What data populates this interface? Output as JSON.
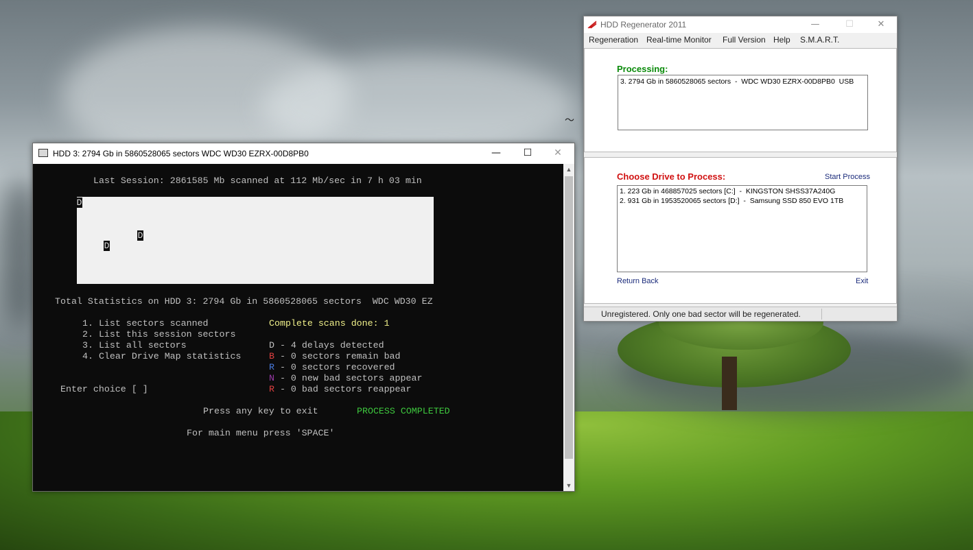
{
  "console": {
    "title": "HDD 3: 2794 Gb in 5860528065 sectors  WDC WD30 EZRX-00D8PB0",
    "minimize": "—",
    "maximize": "☐",
    "close": "✕",
    "last_session": "Last Session: 2861585 Mb scanned at 112 Mb/sec in 7 h 03 min",
    "map_markers": [
      "D",
      "D",
      "D"
    ],
    "total_stats": "Total Statistics on HDD 3: 2794 Gb in 5860528065 sectors  WDC WD30 EZ",
    "menu": [
      "1. List sectors scanned",
      "2. List this session sectors",
      "3. List all sectors",
      "4. Clear Drive Map statistics"
    ],
    "complete_scans": "Complete scans done: 1",
    "legend": [
      {
        "letter": "D",
        "text": " - 4 delays detected",
        "color": "#c0c0c0"
      },
      {
        "letter": "B",
        "text": " - 0 sectors remain bad",
        "color": "#e04040"
      },
      {
        "letter": "R",
        "text": " - 0 sectors recovered",
        "color": "#4a7ce0"
      },
      {
        "letter": "N",
        "text": " - 0 new bad sectors appear",
        "color": "#9a3aa8"
      },
      {
        "letter": "R",
        "text": " - 0 bad sectors reappear",
        "color": "#e04040"
      }
    ],
    "enter_choice": "Enter choice [ ]",
    "press_any_key": "Press any key to exit",
    "process_completed": "PROCESS COMPLETED",
    "main_menu": "For main menu press 'SPACE'"
  },
  "regen": {
    "title": "HDD Regenerator 2011",
    "menu": [
      "Regeneration",
      "Real-time Monitor",
      "Full Version",
      "Help",
      "S.M.A.R.T."
    ],
    "processing_label": "Processing:",
    "processing_item": "3. 2794 Gb in 5860528065 sectors  -  WDC WD30 EZRX-00D8PB0  USB",
    "choose_label": "Choose Drive to Process:",
    "start_process": "Start Process",
    "drives": [
      "1. 223 Gb in 468857025 sectors [C:]  -  KINGSTON SHSS37A240G",
      "2. 931 Gb in 1953520065 sectors [D:]  -  Samsung SSD 850 EVO 1TB"
    ],
    "return_back": "Return Back",
    "exit": "Exit",
    "status": "Unregistered. Only one bad sector will be regenerated."
  },
  "colors": {
    "console_bg": "#0c0c0c",
    "console_text": "#c0c0c0",
    "yellow": "#f0f08a",
    "green": "#3ec83e",
    "regen_green": "#0a8a0a",
    "regen_red": "#d01010"
  }
}
